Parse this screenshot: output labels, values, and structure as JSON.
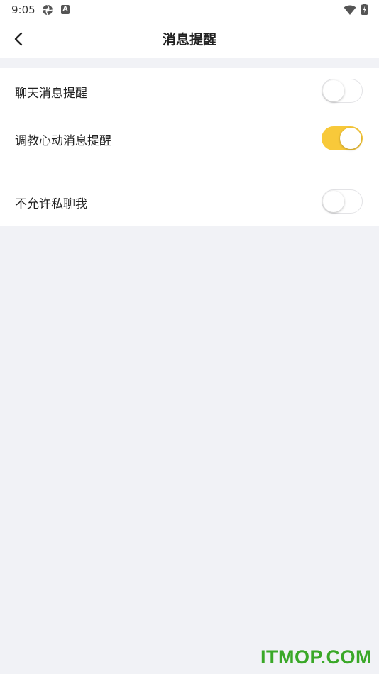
{
  "status_bar": {
    "time": "9:05",
    "notification_icon_letter": "A",
    "icons": [
      "aperture-icon",
      "app-a-icon",
      "wifi-icon",
      "battery-icon"
    ]
  },
  "header": {
    "title": "消息提醒",
    "back_icon": "chevron-left-icon"
  },
  "settings": {
    "items": [
      {
        "label": "聊天消息提醒",
        "enabled": false
      },
      {
        "label": "调教心动消息提醒",
        "enabled": true
      },
      {
        "label": "不允许私聊我",
        "enabled": false
      }
    ]
  },
  "watermark": "ITMOP.COM",
  "colors": {
    "toggle_on": "#f8c93a",
    "background": "#f1f2f6",
    "watermark": "#3aa828"
  }
}
